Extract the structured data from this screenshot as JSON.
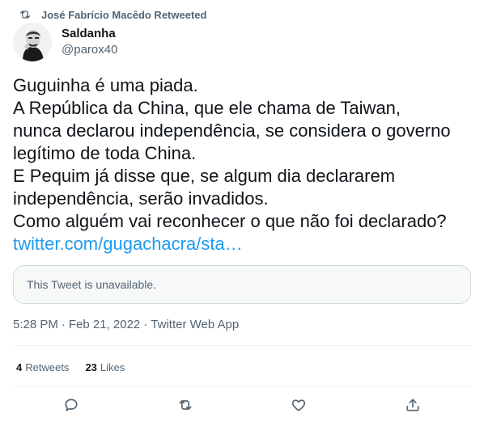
{
  "retweet_banner": {
    "icon": "retweet-icon",
    "text": "José Fabrício Macêdo Retweeted"
  },
  "author": {
    "display_name": "Saldanha",
    "handle": "@parox40",
    "avatar": "avatar-photo"
  },
  "tweet": {
    "lines": [
      "Guguinha é uma piada.",
      "A República da China, que ele chama de Taiwan,",
      "nunca declarou independência, se considera o governo",
      "legítimo de toda China.",
      "E Pequim já disse que, se algum dia declararem",
      "independência, serão invadidos.",
      "Como alguém vai reconhecer o que não foi declarado?"
    ],
    "link": "twitter.com/gugachacra/sta…"
  },
  "quoted": {
    "text": "This Tweet is unavailable."
  },
  "meta": {
    "time": "5:28 PM",
    "date": "Feb 21, 2022",
    "source": "Twitter Web App",
    "separator": "·"
  },
  "stats": {
    "retweets_count": "4",
    "retweets_label": "Retweets",
    "likes_count": "23",
    "likes_label": "Likes"
  },
  "actions": {
    "icons": [
      "reply-icon",
      "retweet-icon",
      "like-icon",
      "share-icon"
    ]
  },
  "colors": {
    "text": "#0f1419",
    "secondary": "#536471",
    "link": "#1d9bf0",
    "border": "#cfd9de"
  }
}
